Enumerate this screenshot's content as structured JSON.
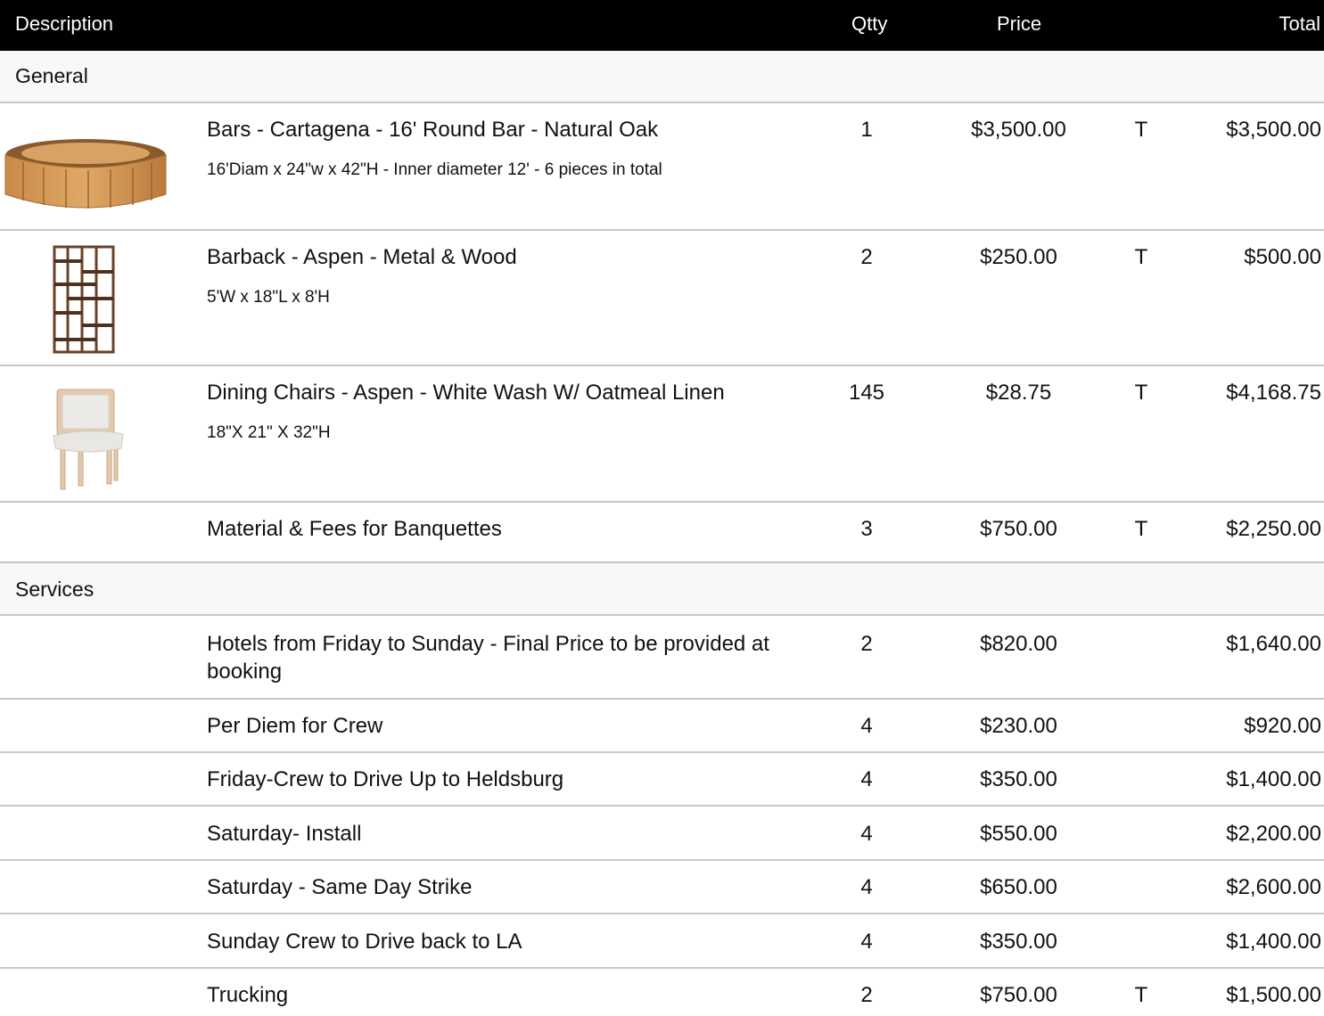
{
  "header": {
    "description": "Description",
    "qty": "Qtty",
    "price": "Price",
    "total": "Total"
  },
  "sections": [
    {
      "name": "General",
      "items": [
        {
          "title": "Bars - Cartagena - 16' Round Bar - Natural Oak",
          "dims": "16'Diam x 24\"w x 42\"H - Inner diameter 12' - 6 pieces in total",
          "qty": "1",
          "price": "$3,500.00",
          "tax": "T",
          "total": "$3,500.00",
          "image": "round-bar-icon"
        },
        {
          "title": "Barback -  Aspen - Metal & Wood",
          "dims": "5'W x 18\"L x 8'H",
          "qty": "2",
          "price": "$250.00",
          "tax": "T",
          "total": "$500.00",
          "image": "barback-shelf-icon"
        },
        {
          "title": "Dining Chairs - Aspen - White Wash W/ Oatmeal Linen",
          "dims": "18\"X 21\" X 32\"H",
          "qty": "145",
          "price": "$28.75",
          "tax": "T",
          "total": "$4,168.75",
          "image": "dining-chair-icon"
        },
        {
          "title": "Material & Fees for Banquettes",
          "dims": "",
          "qty": "3",
          "price": "$750.00",
          "tax": "T",
          "total": "$2,250.00"
        }
      ]
    },
    {
      "name": "Services",
      "items": [
        {
          "title": "Hotels from Friday to Sunday - Final Price to be provided at booking",
          "qty": "2",
          "price": "$820.00",
          "tax": "",
          "total": "$1,640.00"
        },
        {
          "title": "Per Diem for Crew",
          "qty": "4",
          "price": "$230.00",
          "tax": "",
          "total": "$920.00"
        },
        {
          "title": "Friday-Crew to Drive Up to Heldsburg",
          "qty": "4",
          "price": "$350.00",
          "tax": "",
          "total": "$1,400.00"
        },
        {
          "title": "Saturday- Install",
          "qty": "4",
          "price": "$550.00",
          "tax": "",
          "total": "$2,200.00"
        },
        {
          "title": "Saturday - Same Day Strike",
          "qty": "4",
          "price": "$650.00",
          "tax": "",
          "total": "$2,600.00"
        },
        {
          "title": "Sunday Crew to Drive back to LA",
          "qty": "4",
          "price": "$350.00",
          "tax": "",
          "total": "$1,400.00"
        },
        {
          "title": "Trucking",
          "qty": "2",
          "price": "$750.00",
          "tax": "T",
          "total": "$1,500.00"
        }
      ]
    }
  ]
}
